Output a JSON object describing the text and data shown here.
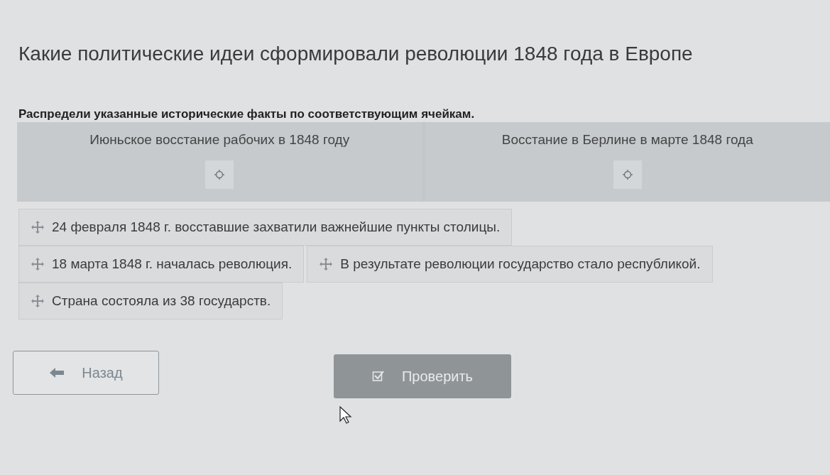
{
  "title": "Какие политические идеи сформировали революции 1848 года в Европе",
  "instruction": "Распредели указанные исторические факты по соответствующим ячейкам.",
  "categories": [
    {
      "label": "Июньское восстание рабочих в 1848 году"
    },
    {
      "label": "Восстание в Берлине в марте 1848 года"
    }
  ],
  "pool_rows": [
    {
      "items": [
        {
          "text": "24 февраля 1848 г. восставшие захватили важнейшие пункты столицы."
        }
      ]
    },
    {
      "items": [
        {
          "text": "18 марта 1848 г. началась революция."
        },
        {
          "text": "В результате революции государство стало республикой."
        }
      ]
    },
    {
      "items": [
        {
          "text": "Страна состояла из 38 государств."
        }
      ]
    }
  ],
  "buttons": [
    {
      "label": "Назад",
      "kind": "back",
      "disabled": false
    },
    {
      "label": "Проверить",
      "kind": "check",
      "disabled": true
    }
  ]
}
